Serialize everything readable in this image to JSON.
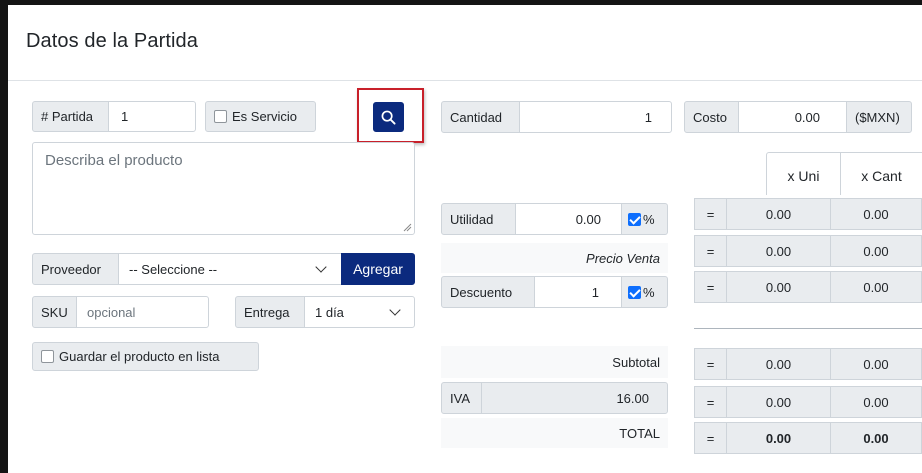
{
  "modal": {
    "title": "Datos de la Partida"
  },
  "left": {
    "partida_label": "# Partida",
    "partida_value": "1",
    "es_servicio_label": "Es Servicio",
    "search_button": "search-icon",
    "description_placeholder": "Describa el producto",
    "proveedor_label": "Proveedor",
    "proveedor_selected": "-- Seleccione --",
    "agregar_label": "Agregar",
    "sku_label": "SKU",
    "sku_placeholder": "opcional",
    "entrega_label": "Entrega",
    "entrega_selected": "1 día",
    "guardar_label": "Guardar el producto en lista"
  },
  "middle": {
    "cantidad_label": "Cantidad",
    "cantidad_value": "1",
    "utilidad_label": "Utilidad",
    "utilidad_value": "0.00",
    "utilidad_pct": "%",
    "precio_venta_label": "Precio Venta",
    "descuento_label": "Descuento",
    "descuento_value": "1",
    "descuento_pct": "%",
    "subtotal_label": "Subtotal",
    "iva_label": "IVA",
    "iva_value": "16.00",
    "total_label": "TOTAL"
  },
  "right": {
    "costo_label": "Costo",
    "costo_value": "0.00",
    "currency_label": "($MXN)",
    "col_uni": "x Uni",
    "col_cant": "x Cant",
    "eq": "=",
    "rows": [
      {
        "uni": "0.00",
        "cant": "0.00"
      },
      {
        "uni": "0.00",
        "cant": "0.00"
      },
      {
        "uni": "0.00",
        "cant": "0.00"
      }
    ],
    "subtotal": {
      "uni": "0.00",
      "cant": "0.00"
    },
    "iva": {
      "uni": "0.00",
      "cant": "0.00"
    },
    "total": {
      "uni": "0.00",
      "cant": "0.00"
    }
  },
  "colors": {
    "navy": "#0b2a7e",
    "highlight": "#c8202a",
    "check": "#0d6efd"
  }
}
